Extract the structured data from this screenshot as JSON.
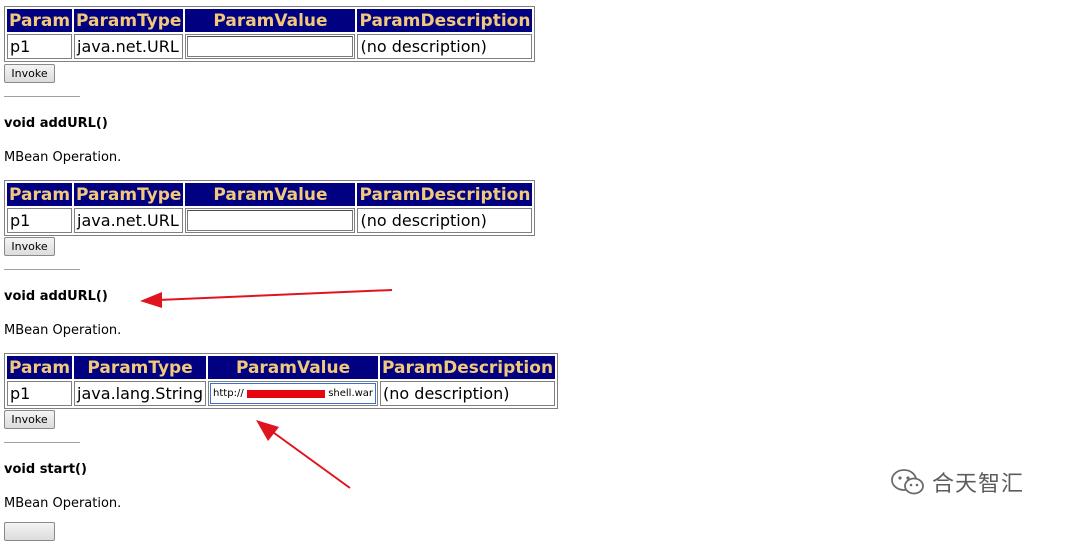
{
  "table_headers": [
    "Param",
    "ParamType",
    "ParamValue",
    "ParamDescription"
  ],
  "blocks": [
    {
      "row": {
        "param": "p1",
        "type": "java.net.URL",
        "value": "",
        "description": "(no description)"
      },
      "invoke_label": "Invoke"
    },
    {
      "title": "void addURL()",
      "description": "MBean Operation.",
      "row": {
        "param": "p1",
        "type": "java.net.URL",
        "value": "",
        "description": "(no description)"
      },
      "invoke_label": "Invoke"
    },
    {
      "title": "void addURL()",
      "description": "MBean Operation.",
      "row": {
        "param": "p1",
        "type": "java.lang.String",
        "value_prefix": "http://",
        "value_suffix": "shell.war",
        "description": "(no description)"
      },
      "invoke_label": "Invoke"
    },
    {
      "title": "void start()",
      "description": "MBean Operation."
    }
  ],
  "watermark": {
    "text": "合天智汇",
    "icon": "wechat-icon"
  },
  "annotations": {
    "arrow_color": "#e0141e",
    "redaction_color": "#e5060f"
  }
}
